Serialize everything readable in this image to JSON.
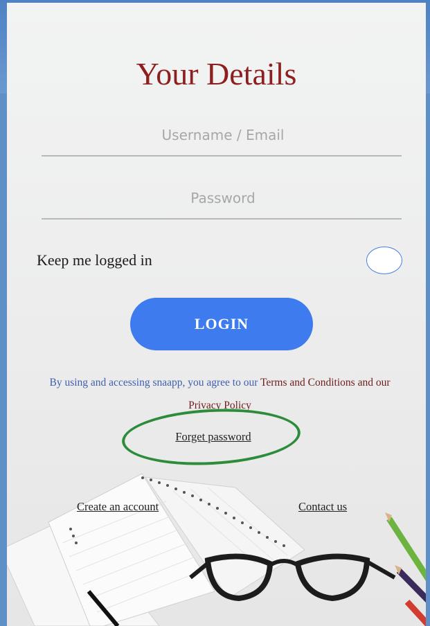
{
  "form": {
    "title": "Your Details",
    "username_placeholder": "Username / Email",
    "password_placeholder": "Password",
    "keep_logged_in_label": "Keep me logged in",
    "login_label": "LOGIN",
    "terms_prefix": "By using and accessing snaapp, you agree to our",
    "terms_link": "Terms and Conditions",
    "terms_middle": "and our",
    "privacy_link": "Privacy Policy",
    "forgot_password": "Forget password",
    "create_account": "Create an account",
    "contact_us": "Contact us"
  },
  "colors": {
    "title": "#8d1f1f",
    "login_button": "#3e7bef",
    "terms_text": "#3e5fae",
    "highlight_ring": "#2d8c3a",
    "header_band": "#4f82c3"
  },
  "decor": {
    "background_scene": "desk-with-notebook-glasses-pencils"
  }
}
